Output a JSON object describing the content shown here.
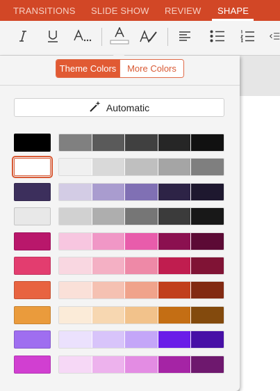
{
  "ribbon": {
    "tabs": [
      {
        "label": "TRANSITIONS"
      },
      {
        "label": "SLIDE SHOW"
      },
      {
        "label": "REVIEW"
      },
      {
        "label": "SHAPE",
        "active": true
      }
    ],
    "accent": "#d24726"
  },
  "toolbar": {
    "icons": [
      "italic-icon",
      "underline-icon",
      "font-size-icon",
      "font-color-icon",
      "highlight-icon",
      "align-left-icon",
      "bullets-icon",
      "numbering-icon",
      "decrease-indent-icon"
    ]
  },
  "popover": {
    "segment": {
      "theme_label": "Theme Colors",
      "more_label": "More Colors",
      "selected": "Theme Colors"
    },
    "automatic_label": "Automatic",
    "rows": [
      {
        "main": "#000000",
        "shades": [
          "#808080",
          "#5a5a5a",
          "#404040",
          "#262626",
          "#111111"
        ]
      },
      {
        "main": "#ffffff",
        "selected": true,
        "shades": [
          "#f0f0f0",
          "#d9d9d9",
          "#bfbfbf",
          "#a5a5a5",
          "#7f7f7f"
        ]
      },
      {
        "main": "#3c2f5c",
        "shades": [
          "#d3cce5",
          "#a99ccf",
          "#8070b4",
          "#2d2346",
          "#1e182f"
        ]
      },
      {
        "main": "#e8e8e8",
        "shades": [
          "#d1d1d1",
          "#aeaeae",
          "#767676",
          "#3b3b3b",
          "#181818"
        ]
      },
      {
        "main": "#b9176b",
        "shades": [
          "#f7c6e0",
          "#f097c6",
          "#e85cab",
          "#8b1050",
          "#5c0a35"
        ]
      },
      {
        "main": "#e33d6f",
        "shades": [
          "#f9d7e1",
          "#f4b0c4",
          "#ee89a7",
          "#c01d4f",
          "#801335"
        ]
      },
      {
        "main": "#e86340",
        "shades": [
          "#fae0d8",
          "#f5c1b2",
          "#f0a38b",
          "#c13f1c",
          "#822a12"
        ]
      },
      {
        "main": "#ea9b3c",
        "shades": [
          "#fbebd8",
          "#f7d7b1",
          "#f2c28b",
          "#c46e14",
          "#834a0d"
        ]
      },
      {
        "main": "#9f6ef0",
        "shades": [
          "#ebe1fd",
          "#d8c4fa",
          "#c4a6f8",
          "#6a1de8",
          "#4710a6"
        ]
      },
      {
        "main": "#d13fd1",
        "shades": [
          "#f6d8f6",
          "#edb2ed",
          "#e38ce3",
          "#a524a5",
          "#6e186e"
        ]
      }
    ]
  }
}
